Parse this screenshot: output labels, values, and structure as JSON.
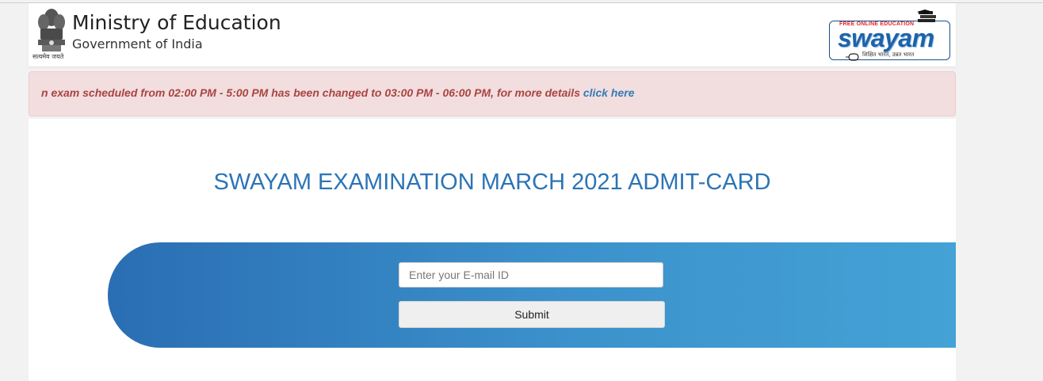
{
  "header": {
    "ministry_title": "Ministry of Education",
    "ministry_subtitle": "Government of India",
    "emblem_caption": "सत्यमेव जयते",
    "emblem_icon": "national-emblem-icon",
    "logo": {
      "tagline_top": "FREE ONLINE EDUCATION",
      "wordmark": "swayam",
      "tagline_bottom": "शिक्षित भारत, उन्नत भारत",
      "icon": "swayam-logo-icon"
    }
  },
  "alert": {
    "message": "n exam scheduled from 02:00 PM - 5:00 PM has been changed to 03:00 PM - 06:00 PM, for more details ",
    "link_text": "click here"
  },
  "main": {
    "title": "SWAYAM EXAMINATION MARCH 2021 ADMIT-CARD"
  },
  "form": {
    "email_value": "",
    "email_placeholder": "Enter your E-mail ID",
    "submit_label": "Submit"
  },
  "colors": {
    "title": "#2c74b6",
    "alert_bg": "#f2dede",
    "alert_text": "#a94442",
    "link": "#337ab7",
    "band_start": "#2a6eb3",
    "band_end": "#44a2d6"
  }
}
